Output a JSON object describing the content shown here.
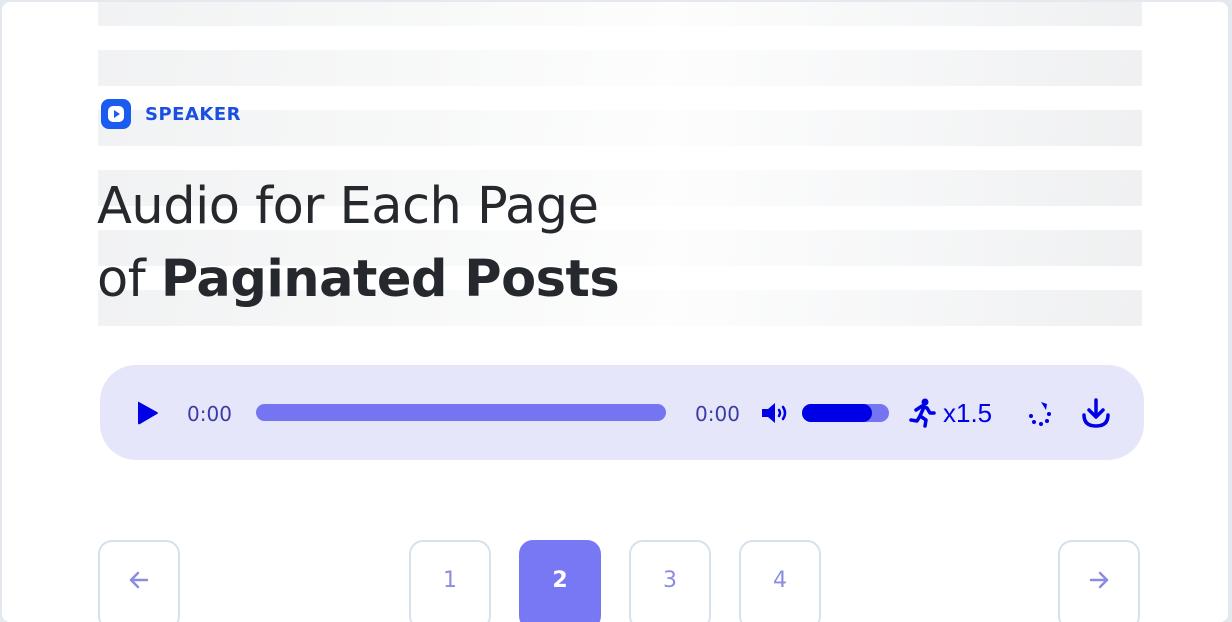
{
  "brand": {
    "name": "SPEAKER",
    "logo_icon": "play-logo-icon",
    "color": "#1a5cf0"
  },
  "title": {
    "line1": "Audio for Each Page",
    "line2_regular": "of",
    "line2_bold": "Paginated Posts"
  },
  "player": {
    "current_time": "0:00",
    "duration": "0:00",
    "progress_percent": 0,
    "volume_percent": 80,
    "speed_label": "x1.5",
    "icons": [
      "play-icon",
      "volume-icon",
      "running-speed-icon",
      "loop-icon",
      "download-icon"
    ],
    "colors": {
      "background": "#e6e6fa",
      "accent": "#0000e6",
      "track": "#7575f2"
    }
  },
  "pagination": {
    "prev_icon": "arrow-left-icon",
    "next_icon": "arrow-right-icon",
    "pages": [
      "1",
      "2",
      "3",
      "4"
    ],
    "active_page": "2",
    "active_color": "#7878f5"
  }
}
